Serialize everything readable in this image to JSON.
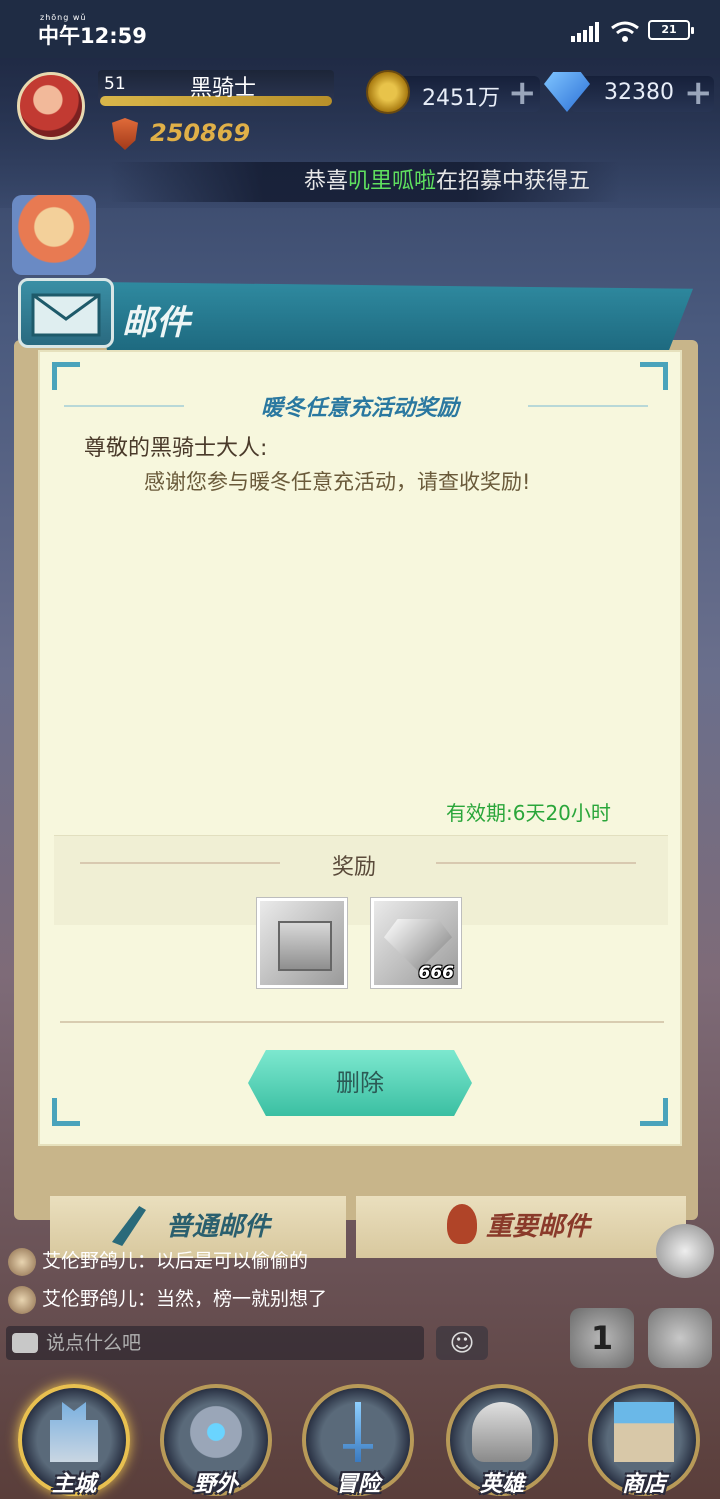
{
  "status_bar": {
    "time_pinyin": "zhōng wǔ",
    "time": "中午12:59",
    "battery": "21"
  },
  "player": {
    "level": "51",
    "name": "黑骑士",
    "power": "250869"
  },
  "resources": {
    "gold": "2451万",
    "gems": "32380"
  },
  "notice": {
    "prefix": "恭喜",
    "highlight": "叽里呱啦",
    "suffix": "在招募中获得五"
  },
  "mail_panel": {
    "title": "邮件"
  },
  "mail": {
    "subject": "暖冬任意充活动奖励",
    "greeting": "尊敬的黑骑士大人:",
    "body": "感谢您参与暖冬任意充活动，请查收奖励!",
    "validity": "有效期:6天20小时",
    "reward_title": "奖励",
    "rewards": [
      {
        "icon": "silver-gift-box-icon",
        "qty": ""
      },
      {
        "icon": "diamond-icon",
        "qty": "666"
      }
    ],
    "delete_label": "删除"
  },
  "mail_tabs": {
    "normal": "普通邮件",
    "important": "重要邮件"
  },
  "chat": {
    "messages": [
      "艾伦野鸽儿：以后是可以偷偷的",
      "艾伦野鸽儿：当然，榜一就别想了"
    ],
    "placeholder": "说点什么吧",
    "rank_badge": "1"
  },
  "bottom_nav": [
    {
      "label": "主城",
      "icon": "castle-icon",
      "active": true
    },
    {
      "label": "野外",
      "icon": "wild-gate-icon",
      "active": false
    },
    {
      "label": "冒险",
      "icon": "sword-icon",
      "active": false
    },
    {
      "label": "英雄",
      "icon": "helmet-icon",
      "active": false
    },
    {
      "label": "商店",
      "icon": "shop-icon",
      "active": false
    }
  ],
  "colors": {
    "accent_teal": "#3bbfa2",
    "mail_title_blue": "#2a78a0",
    "validity_green": "#2aa63a",
    "power_gold": "#e0b048"
  }
}
